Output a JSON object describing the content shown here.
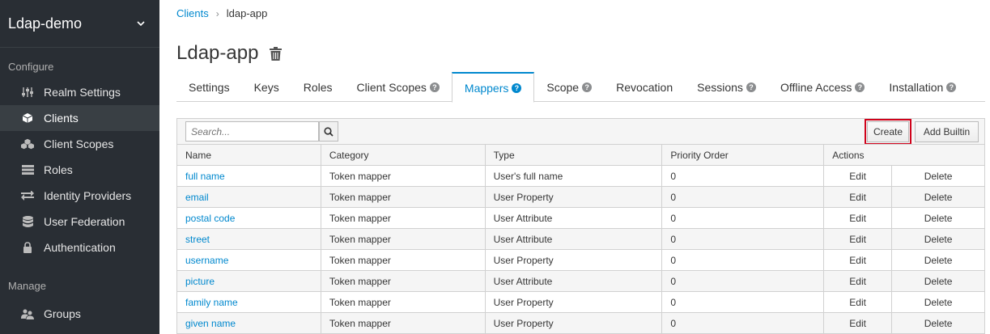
{
  "realm": {
    "name": "Ldap-demo"
  },
  "sidebar": {
    "configure_label": "Configure",
    "manage_label": "Manage",
    "items": [
      {
        "label": "Realm Settings",
        "icon": "sliders-icon"
      },
      {
        "label": "Clients",
        "icon": "cube-icon"
      },
      {
        "label": "Client Scopes",
        "icon": "cubes-icon"
      },
      {
        "label": "Roles",
        "icon": "list-icon"
      },
      {
        "label": "Identity Providers",
        "icon": "exchange-icon"
      },
      {
        "label": "User Federation",
        "icon": "database-icon"
      },
      {
        "label": "Authentication",
        "icon": "lock-icon"
      }
    ],
    "manage_items": [
      {
        "label": "Groups",
        "icon": "users-icon"
      }
    ]
  },
  "breadcrumb": {
    "parent": "Clients",
    "current": "ldap-app"
  },
  "page": {
    "title": "Ldap-app"
  },
  "tabs": [
    {
      "label": "Settings",
      "help": false
    },
    {
      "label": "Keys",
      "help": false
    },
    {
      "label": "Roles",
      "help": false
    },
    {
      "label": "Client Scopes",
      "help": true
    },
    {
      "label": "Mappers",
      "help": true,
      "active": true
    },
    {
      "label": "Scope",
      "help": true
    },
    {
      "label": "Revocation",
      "help": false
    },
    {
      "label": "Sessions",
      "help": true
    },
    {
      "label": "Offline Access",
      "help": true
    },
    {
      "label": "Installation",
      "help": true
    }
  ],
  "toolbar": {
    "search_placeholder": "Search...",
    "create_label": "Create",
    "add_builtin_label": "Add Builtin"
  },
  "table": {
    "headers": [
      "Name",
      "Category",
      "Type",
      "Priority Order",
      "Actions"
    ],
    "edit_label": "Edit",
    "delete_label": "Delete",
    "rows": [
      {
        "name": "full name",
        "category": "Token mapper",
        "type": "User's full name",
        "priority": "0"
      },
      {
        "name": "email",
        "category": "Token mapper",
        "type": "User Property",
        "priority": "0"
      },
      {
        "name": "postal code",
        "category": "Token mapper",
        "type": "User Attribute",
        "priority": "0"
      },
      {
        "name": "street",
        "category": "Token mapper",
        "type": "User Attribute",
        "priority": "0"
      },
      {
        "name": "username",
        "category": "Token mapper",
        "type": "User Property",
        "priority": "0"
      },
      {
        "name": "picture",
        "category": "Token mapper",
        "type": "User Attribute",
        "priority": "0"
      },
      {
        "name": "family name",
        "category": "Token mapper",
        "type": "User Property",
        "priority": "0"
      },
      {
        "name": "given name",
        "category": "Token mapper",
        "type": "User Property",
        "priority": "0"
      }
    ]
  },
  "colors": {
    "accent": "#0088ce",
    "sidebar_bg": "#292e34",
    "highlight": "#d0021b"
  }
}
